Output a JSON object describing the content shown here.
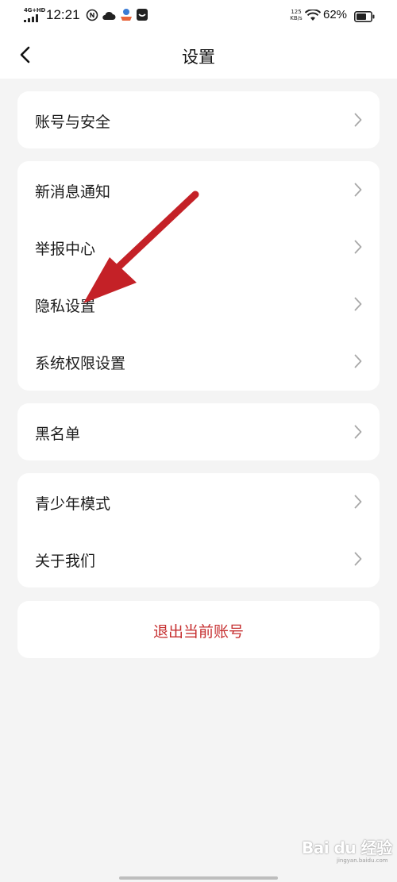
{
  "status_bar": {
    "network": "4G+HD",
    "time": "12:21",
    "net_speed_value": "125",
    "net_speed_unit": "KB/s",
    "battery": "62%"
  },
  "header": {
    "title": "设置"
  },
  "sections": [
    {
      "items": [
        {
          "label": "账号与安全"
        }
      ]
    },
    {
      "items": [
        {
          "label": "新消息通知"
        },
        {
          "label": "举报中心"
        },
        {
          "label": "隐私设置"
        },
        {
          "label": "系统权限设置"
        }
      ]
    },
    {
      "items": [
        {
          "label": "黑名单"
        }
      ]
    },
    {
      "items": [
        {
          "label": "青少年模式"
        },
        {
          "label": "关于我们"
        }
      ]
    }
  ],
  "logout": {
    "label": "退出当前账号"
  },
  "watermark": {
    "main": "Bai du 经验",
    "sub": "jingyan.baidu.com"
  },
  "colors": {
    "accent": "#c62f30",
    "background": "#f4f4f4",
    "card": "#ffffff",
    "arrow": "#c42127"
  }
}
